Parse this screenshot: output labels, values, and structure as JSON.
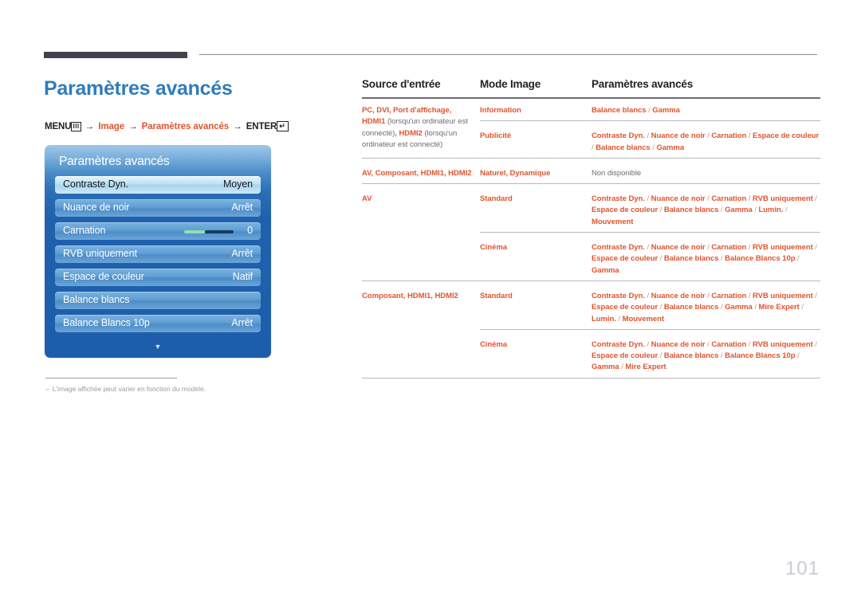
{
  "page_title": "Paramètres avancés",
  "breadcrumb": {
    "menu_label": "MENU",
    "menu_glyph": "III",
    "arrow": "→",
    "item1": "Image",
    "item2": "Paramètres avancés",
    "enter_label": "ENTER",
    "enter_glyph": "↵"
  },
  "osd": {
    "title": "Paramètres avancés",
    "scroll_icon": "▼",
    "items": [
      {
        "label": "Contraste Dyn.",
        "value": "Moyen",
        "selected": true,
        "slider": false
      },
      {
        "label": "Nuance de noir",
        "value": "Arrêt",
        "selected": false,
        "slider": false
      },
      {
        "label": "Carnation",
        "value": "0",
        "selected": false,
        "slider": true
      },
      {
        "label": "RVB uniquement",
        "value": "Arrêt",
        "selected": false,
        "slider": false
      },
      {
        "label": "Espace de couleur",
        "value": "Natif",
        "selected": false,
        "slider": false
      },
      {
        "label": "Balance blancs",
        "value": "",
        "selected": false,
        "slider": false
      },
      {
        "label": "Balance Blancs 10p",
        "value": "Arrêt",
        "selected": false,
        "slider": false
      }
    ]
  },
  "footnote": {
    "dash": "‒",
    "text": "L'image affichée peut varier en fonction du modèle."
  },
  "table": {
    "headers": [
      "Source d'entrée",
      "Mode Image",
      "Paramètres avancés"
    ],
    "rows": [
      {
        "source": "PC, DVI, Port d'affichage, HDMI1 (lorsqu'un ordinateur est connecté), HDMI2 (lorsqu'un ordinateur est connecté)",
        "subrows": [
          {
            "mode": "Information",
            "settings": "Balance blancs / Gamma"
          },
          {
            "mode": "Publicité",
            "settings": "Contraste Dyn. / Nuance de noir / Carnation / Espace de couleur / Balance blancs / Gamma"
          }
        ]
      },
      {
        "source": "AV, Composant, HDMI1, HDMI2",
        "subrows": [
          {
            "mode": "Naturel, Dynamique",
            "settings": "Non disponible",
            "unavailable": true
          }
        ]
      },
      {
        "source": "AV",
        "subrows": [
          {
            "mode": "Standard",
            "settings": "Contraste Dyn. / Nuance de noir / Carnation / RVB uniquement / Espace de couleur / Balance blancs / Gamma / Lumin./Mouvement"
          },
          {
            "mode": "Cinéma",
            "settings": "Contraste Dyn. / Nuance de noir / Carnation / RVB uniquement / Espace de couleur / Balance blancs / Balance Blancs 10p / Gamma"
          }
        ]
      },
      {
        "source": "Composant, HDMI1, HDMI2",
        "subrows": [
          {
            "mode": "Standard",
            "settings": "Contraste Dyn. / Nuance de noir / Carnation / RVB uniquement / Espace de couleur / Balance blancs / Gamma / Mire Expert / Lumin./Mouvement"
          },
          {
            "mode": "Cinéma",
            "settings": "Contraste Dyn. / Nuance de noir / Carnation / RVB uniquement / Espace de couleur / Balance blancs / Balance Blancs 10p / Gamma / Mire Expert"
          }
        ]
      }
    ]
  },
  "page_number": "101",
  "colors": {
    "accent_blue": "#2f7cbd",
    "accent_orange": "#e0542e",
    "rule_dark": "#44414f",
    "page_number_gray": "#c8cbd6"
  }
}
